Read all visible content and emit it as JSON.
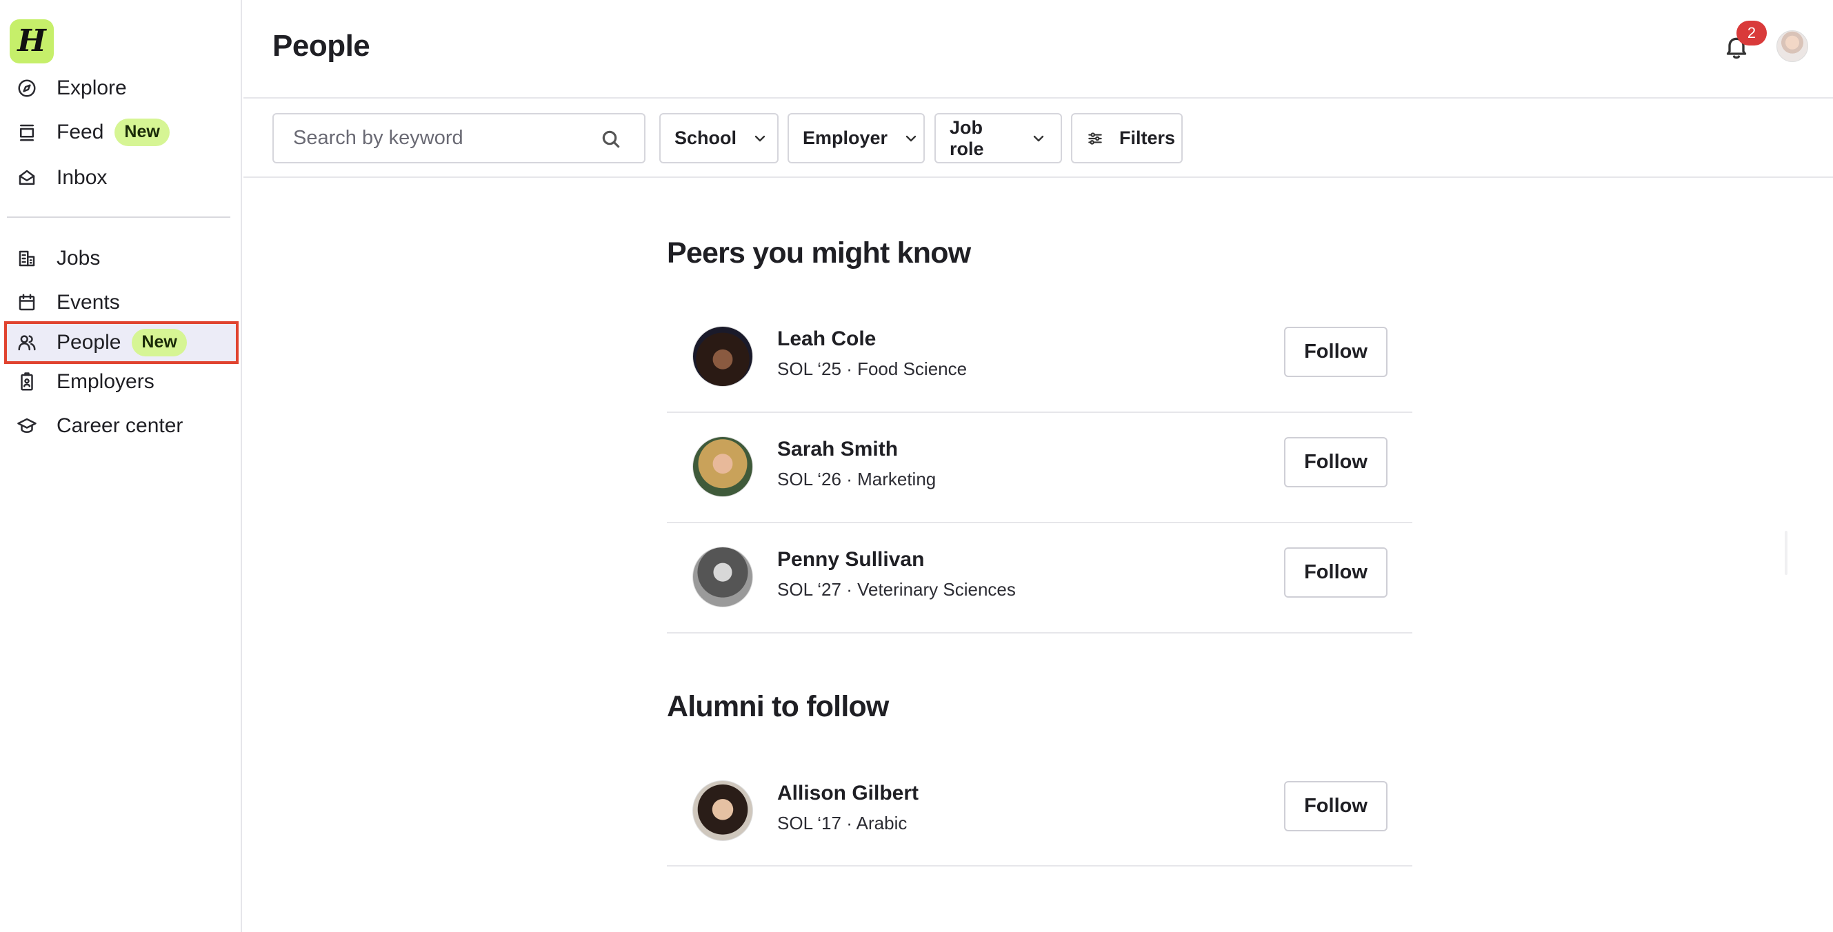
{
  "app": {
    "logo_letter": "H"
  },
  "sidebar": {
    "items": [
      {
        "label": "Explore",
        "icon": "compass-icon",
        "badge": ""
      },
      {
        "label": "Feed",
        "icon": "feed-icon",
        "badge": "New"
      },
      {
        "label": "Inbox",
        "icon": "inbox-icon",
        "badge": ""
      },
      {
        "label": "Jobs",
        "icon": "buildings-icon",
        "badge": ""
      },
      {
        "label": "Events",
        "icon": "calendar-icon",
        "badge": ""
      },
      {
        "label": "People",
        "icon": "people-icon",
        "badge": "New",
        "active": true
      },
      {
        "label": "Employers",
        "icon": "badge-id-icon",
        "badge": ""
      },
      {
        "label": "Career center",
        "icon": "graduation-cap-icon",
        "badge": ""
      }
    ]
  },
  "header": {
    "title": "People",
    "notification_count": "2"
  },
  "filters": {
    "search_placeholder": "Search by keyword",
    "school": "School",
    "employer": "Employer",
    "job_role": "Job role",
    "more": "Filters"
  },
  "sections": {
    "peers": {
      "title": "Peers you might know",
      "people": [
        {
          "name": "Leah Cole",
          "meta": "SOL ‘25 · Food Science",
          "action": "Follow"
        },
        {
          "name": "Sarah Smith",
          "meta": "SOL ‘26 · Marketing",
          "action": "Follow"
        },
        {
          "name": "Penny Sullivan",
          "meta": "SOL ‘27 · Veterinary Sciences",
          "action": "Follow"
        }
      ]
    },
    "alumni": {
      "title": "Alumni to follow",
      "people": [
        {
          "name": "Allison Gilbert",
          "meta": "SOL ‘17 · Arabic",
          "action": "Follow"
        }
      ]
    }
  },
  "colors": {
    "brand_green": "#c6ef6a",
    "badge_green": "#d6f594",
    "notification_red": "#d93a3a",
    "active_highlight": "#e0432f"
  }
}
